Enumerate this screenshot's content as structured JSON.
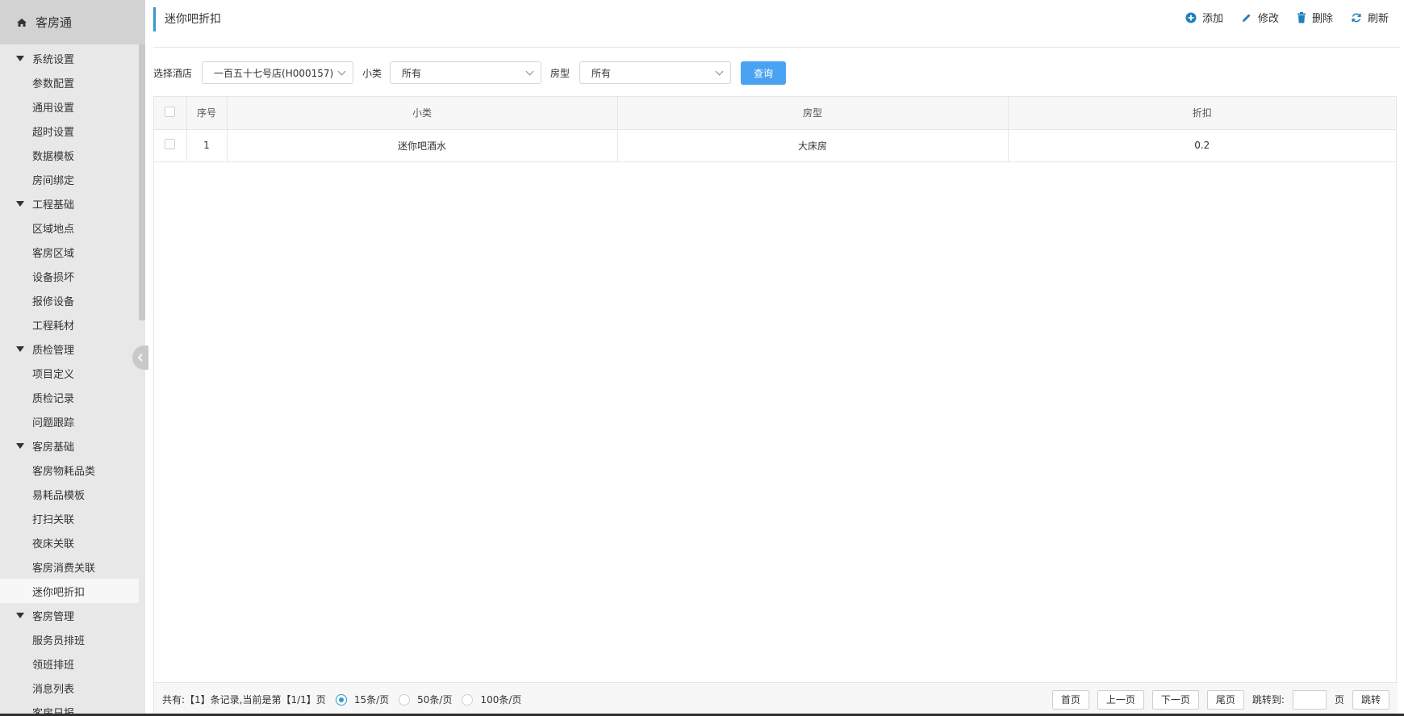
{
  "app": {
    "title": "客房通",
    "home_icon": "home-icon"
  },
  "sidebar": {
    "groups": [
      {
        "label": "系统设置",
        "items": [
          "参数配置",
          "通用设置",
          "超时设置",
          "数据模板",
          "房间绑定"
        ]
      },
      {
        "label": "工程基础",
        "items": [
          "区域地点",
          "客房区域",
          "设备损坏",
          "报修设备",
          "工程耗材"
        ]
      },
      {
        "label": "质检管理",
        "items": [
          "项目定义",
          "质检记录",
          "问题跟踪"
        ]
      },
      {
        "label": "客房基础",
        "items": [
          "客房物耗品类",
          "易耗品模板",
          "打扫关联",
          "夜床关联",
          "客房消费关联",
          "迷你吧折扣"
        ]
      },
      {
        "label": "客房管理",
        "items": [
          "服务员排班",
          "领班排班",
          "消息列表",
          "客房日报"
        ]
      }
    ],
    "active_item": "迷你吧折扣"
  },
  "header": {
    "page_title": "迷你吧折扣",
    "actions": [
      {
        "label": "添加",
        "icon": "plus-circle-icon"
      },
      {
        "label": "修改",
        "icon": "pencil-icon"
      },
      {
        "label": "删除",
        "icon": "trash-icon"
      },
      {
        "label": "刷新",
        "icon": "refresh-icon"
      }
    ]
  },
  "filters": {
    "hotel_label": "选择酒店",
    "hotel_value": "一百五十七号店(H000157)",
    "subclass_label": "小类",
    "subclass_value": "所有",
    "roomtype_label": "房型",
    "roomtype_value": "所有",
    "query_label": "查询"
  },
  "table": {
    "columns": [
      "序号",
      "小类",
      "房型",
      "折扣"
    ],
    "rows": [
      {
        "index": "1",
        "subclass": "迷你吧酒水",
        "room_type": "大床房",
        "discount": "0.2"
      }
    ]
  },
  "footer": {
    "summary": "共有:【1】条记录,当前是第【1/1】页",
    "page_sizes": [
      "15条/页",
      "50条/页",
      "100条/页"
    ],
    "selected_page_size": "15条/页",
    "first": "首页",
    "prev": "上一页",
    "next": "下一页",
    "last": "尾页",
    "jump_label": "跳转到:",
    "page_unit": "页",
    "jump_button": "跳转"
  },
  "colors": {
    "accent": "#3399cc",
    "query_button": "#4aa3f2",
    "sidebar_bg": "#e8e8e8"
  }
}
